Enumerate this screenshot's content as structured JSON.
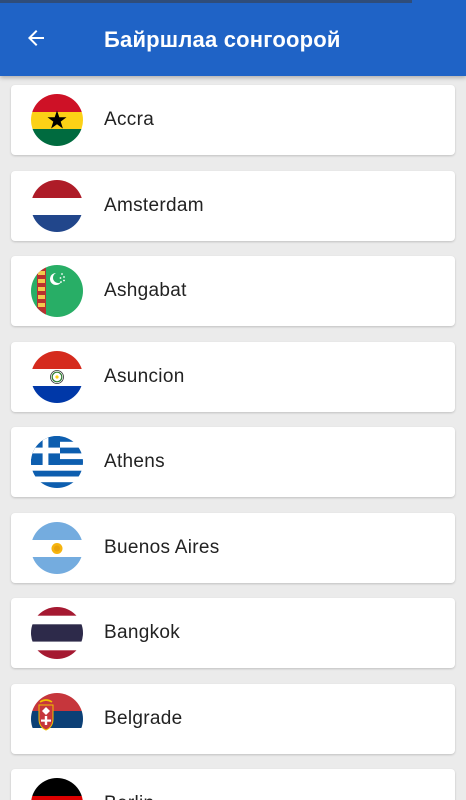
{
  "header": {
    "title": "Байршлаа сонгоорой",
    "back_icon": "arrow-left-icon",
    "background_color": "#1f63c6"
  },
  "cities": [
    {
      "name": "Accra",
      "flag": "ghana-flag-icon"
    },
    {
      "name": "Amsterdam",
      "flag": "netherlands-flag-icon"
    },
    {
      "name": "Ashgabat",
      "flag": "turkmenistan-flag-icon"
    },
    {
      "name": "Asuncion",
      "flag": "paraguay-flag-icon"
    },
    {
      "name": "Athens",
      "flag": "greece-flag-icon"
    },
    {
      "name": "Buenos Aires",
      "flag": "argentina-flag-icon"
    },
    {
      "name": "Bangkok",
      "flag": "thailand-flag-icon"
    },
    {
      "name": "Belgrade",
      "flag": "serbia-flag-icon"
    },
    {
      "name": "Berlin",
      "flag": "germany-flag-icon"
    }
  ]
}
